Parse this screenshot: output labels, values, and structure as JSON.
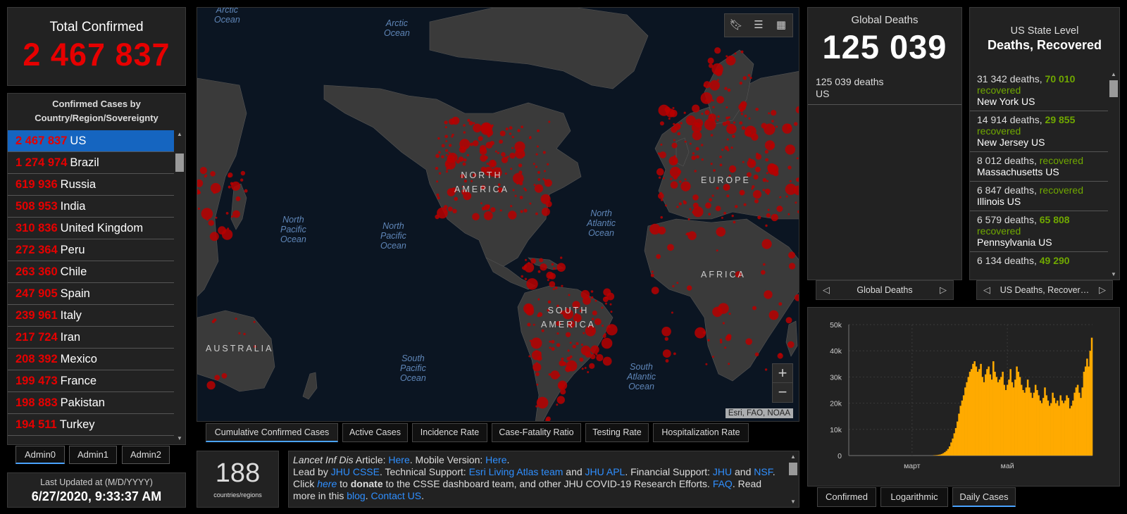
{
  "total": {
    "label": "Total Confirmed",
    "value": "2 467 837"
  },
  "countries": {
    "header": "Confirmed Cases by Country/Region/Sovereignty",
    "items": [
      {
        "num": "2 467 837",
        "name": "US"
      },
      {
        "num": "1 274 974",
        "name": "Brazil"
      },
      {
        "num": "619 936",
        "name": "Russia"
      },
      {
        "num": "508 953",
        "name": "India"
      },
      {
        "num": "310 836",
        "name": "United Kingdom"
      },
      {
        "num": "272 364",
        "name": "Peru"
      },
      {
        "num": "263 360",
        "name": "Chile"
      },
      {
        "num": "247 905",
        "name": "Spain"
      },
      {
        "num": "239 961",
        "name": "Italy"
      },
      {
        "num": "217 724",
        "name": "Iran"
      },
      {
        "num": "208 392",
        "name": "Mexico"
      },
      {
        "num": "199 473",
        "name": "France"
      },
      {
        "num": "198 883",
        "name": "Pakistan"
      },
      {
        "num": "194 511",
        "name": "Turkey"
      }
    ],
    "scroll_position": 0.05
  },
  "admin_tabs": [
    "Admin0",
    "Admin1",
    "Admin2"
  ],
  "updated": {
    "label": "Last Updated at (M/D/YYYY)",
    "value": "6/27/2020, 9:33:37 AM"
  },
  "map": {
    "oceans": [
      {
        "line1": "Arctic",
        "line2": "Ocean"
      },
      {
        "line1": "Arctic",
        "line2": "Ocean"
      },
      {
        "line1": "North",
        "line2": "Pacific",
        "line3": "Ocean"
      },
      {
        "line1": "North",
        "line2": "Pacific",
        "line3": "Ocean"
      },
      {
        "line1": "North",
        "line2": "Atlantic",
        "line3": "Ocean"
      },
      {
        "line1": "South",
        "line2": "Pacific",
        "line3": "Ocean"
      },
      {
        "line1": "South",
        "line2": "Atlantic",
        "line3": "Ocean"
      }
    ],
    "continents": [
      {
        "line1": "NORTH",
        "line2": "AMERICA"
      },
      {
        "line1": "EUROPE"
      },
      {
        "line1": "AFRICA"
      },
      {
        "line1": "SOUTH",
        "line2": "AMERICA"
      },
      {
        "line1": "AUSTRALIA"
      }
    ],
    "tools": {
      "bookmark": "bookmark-icon",
      "list": "list-icon",
      "qr": "qr-icon"
    },
    "zoom_in": "+",
    "zoom_out": "−",
    "attribution": "Esri, FAO, NOAA",
    "colors": {
      "land": "#3a3a3a",
      "ocean": "#0b1522",
      "bubble": "#b80000"
    }
  },
  "map_tabs": [
    "Cumulative Confirmed Cases",
    "Active Cases",
    "Incidence Rate",
    "Case-Fatality Ratio",
    "Testing Rate",
    "Hospitalization Rate"
  ],
  "count": {
    "value": "188",
    "label": "countries/regions"
  },
  "info": {
    "p1": "Lancet Inf Dis",
    "p2": " Article: ",
    "p3": "Here",
    "p4": ". Mobile Version: ",
    "p5": "Here",
    "p6": ".",
    "p7": "Lead by ",
    "p8": "JHU CSSE",
    "p9": ". Technical Support: ",
    "p10": "Esri Living Atlas team",
    "p11": " and ",
    "p12": "JHU APL",
    "p13": ". Financial Support: ",
    "p14": "JHU",
    "p15": " and ",
    "p16": "NSF",
    "p17": ". Click ",
    "p18": "here",
    "p19": " to ",
    "p20": "donate",
    "p21": " to the CSSE dashboard team, and other JHU COVID-19 Research Efforts. ",
    "p22": "FAQ",
    "p23": ". Read more in this ",
    "p24": "blog",
    "p25": ". ",
    "p26": "Contact US",
    "p27": "."
  },
  "global_deaths": {
    "label": "Global Deaths",
    "value": "125 039",
    "rows": [
      {
        "n": "125 039",
        "unit": " deaths",
        "place": "US"
      }
    ],
    "pager": "Global Deaths"
  },
  "states": {
    "title1": "US State Level",
    "title2": "Deaths, Recovered",
    "items": [
      {
        "deaths": "31 342 deaths, ",
        "recovered_num": "70 010",
        "recovered": "recovered",
        "place": "New York US"
      },
      {
        "deaths": "14 914 deaths, ",
        "recovered_num": "29 855",
        "recovered": "recovered",
        "place": "New Jersey US"
      },
      {
        "deaths": "8 012 deaths, ",
        "recovered_num": "",
        "recovered": "recovered",
        "place": "Massachusetts US"
      },
      {
        "deaths": "6 847 deaths, ",
        "recovered_num": "",
        "recovered": "recovered",
        "place": "Illinois US"
      },
      {
        "deaths": "6 579 deaths, ",
        "recovered_num": "65 808",
        "recovered": "recovered",
        "place": "Pennsylvania US"
      },
      {
        "deaths": "6 134 deaths, ",
        "recovered_num": "49 290",
        "recovered": "",
        "place": ""
      }
    ],
    "pager": "US Deaths, Recover…",
    "scroll_position": 0.0
  },
  "chart_data": {
    "type": "bar",
    "title": "",
    "xlabel": "",
    "ylabel": "",
    "ylim": [
      0,
      50000
    ],
    "yticks": [
      "0",
      "10k",
      "20k",
      "30k",
      "40k",
      "50k"
    ],
    "xticks": [
      {
        "label": "март",
        "day": 40
      },
      {
        "label": "май",
        "day": 101
      }
    ],
    "color": "#ffaa00",
    "grid": true,
    "values": [
      0,
      0,
      0,
      0,
      0,
      0,
      0,
      0,
      0,
      0,
      0,
      0,
      0,
      0,
      0,
      0,
      0,
      0,
      0,
      0,
      0,
      0,
      0,
      0,
      0,
      0,
      0,
      0,
      0,
      0,
      0,
      0,
      0,
      0,
      0,
      0,
      0,
      0,
      0,
      0,
      0,
      0,
      0,
      0,
      0,
      0,
      0,
      0,
      0,
      0,
      0,
      0,
      0,
      0,
      100,
      150,
      200,
      300,
      400,
      600,
      900,
      1300,
      1800,
      2500,
      3500,
      5000,
      6500,
      8500,
      10500,
      13000,
      16000,
      19000,
      21000,
      23000,
      26000,
      28000,
      30000,
      32000,
      33000,
      35000,
      36000,
      34000,
      32000,
      33000,
      35000,
      30000,
      28000,
      31000,
      33000,
      34000,
      31000,
      29000,
      36000,
      32000,
      30000,
      28000,
      29000,
      30000,
      32000,
      27000,
      25000,
      27000,
      29000,
      33000,
      28000,
      26000,
      29000,
      34000,
      32000,
      30000,
      27000,
      25000,
      24000,
      26000,
      29000,
      26000,
      24000,
      22000,
      24000,
      27000,
      25000,
      23000,
      21000,
      20000,
      22000,
      26000,
      23000,
      21000,
      19000,
      20000,
      24000,
      22000,
      20000,
      21000,
      19000,
      23000,
      21000,
      20000,
      21000,
      23000,
      22000,
      18000,
      19000,
      21000,
      24000,
      26000,
      27000,
      24000,
      22000,
      26000,
      32000,
      34000,
      37000,
      34000,
      40000,
      45000
    ]
  }
}
